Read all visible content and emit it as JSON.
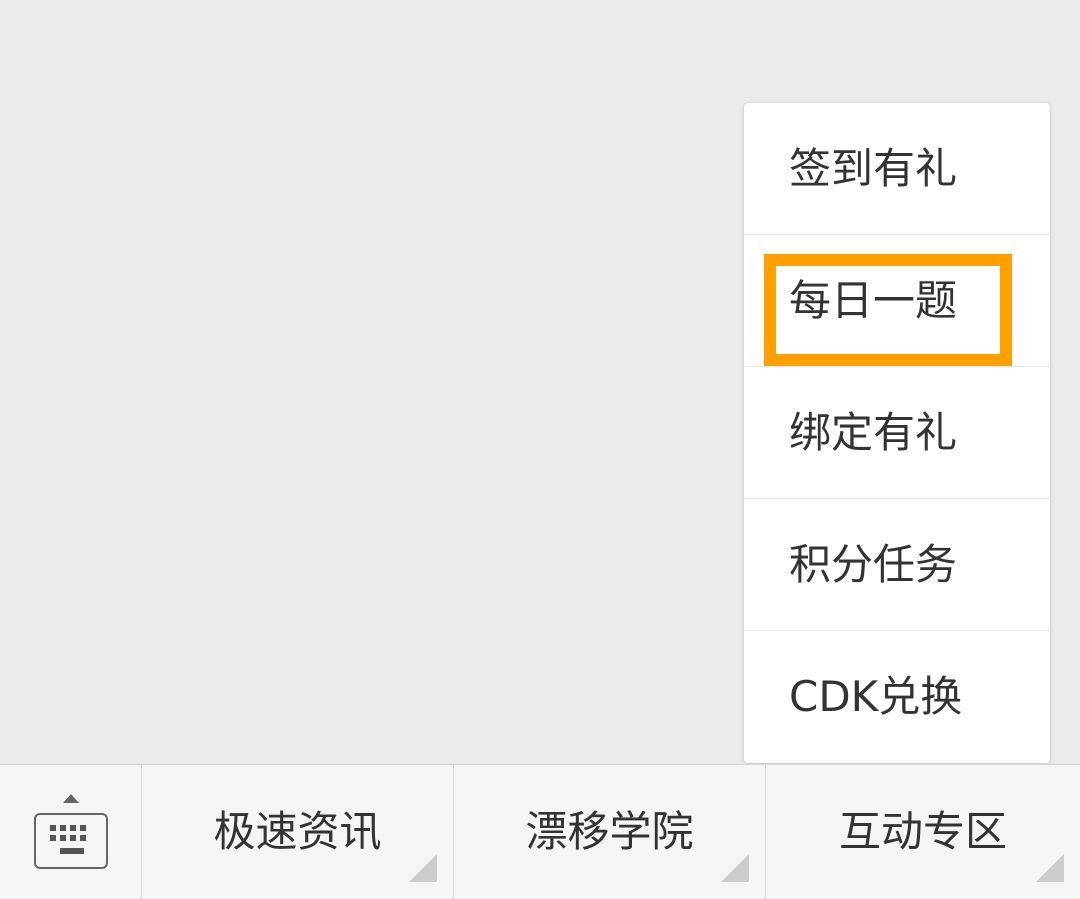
{
  "popup_menu": {
    "items": [
      {
        "label": "签到有礼",
        "highlighted": false
      },
      {
        "label": "每日一题",
        "highlighted": true
      },
      {
        "label": "绑定有礼",
        "highlighted": false
      },
      {
        "label": "积分任务",
        "highlighted": false
      },
      {
        "label": "CDK兑换",
        "highlighted": false
      }
    ],
    "highlight_color": "#ffa000"
  },
  "bottom_bar": {
    "keyboard_icon": "keyboard-icon",
    "tabs": [
      {
        "label": "极速资讯"
      },
      {
        "label": "漂移学院"
      },
      {
        "label": "互动专区"
      }
    ]
  }
}
